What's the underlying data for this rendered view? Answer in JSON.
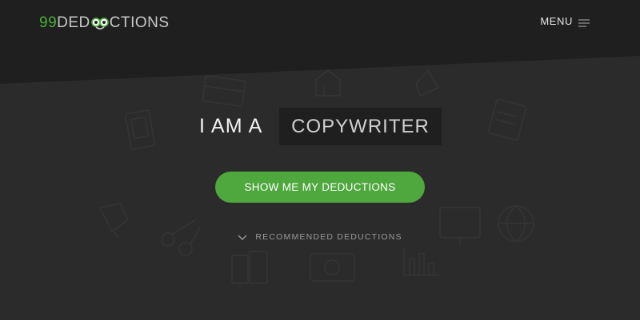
{
  "logo": {
    "number": "99",
    "text_before": "DED",
    "text_after": "CTIONS",
    "icon": "owl-eyes-icon"
  },
  "nav": {
    "menu_label": "MENU",
    "menu_icon": "hamburger-icon"
  },
  "hero": {
    "prefix": "I AM A",
    "profession": "COPYWRITER"
  },
  "cta": {
    "label": "SHOW ME MY DEDUCTIONS"
  },
  "recommended": {
    "label": "RECOMMENDED DEDUCTIONS",
    "icon": "chevron-down-icon"
  },
  "colors": {
    "background": "#2b2b2b",
    "band": "#1e1e1e",
    "accent_green": "#4ea83d",
    "profession_box": "#1f1f1f"
  }
}
